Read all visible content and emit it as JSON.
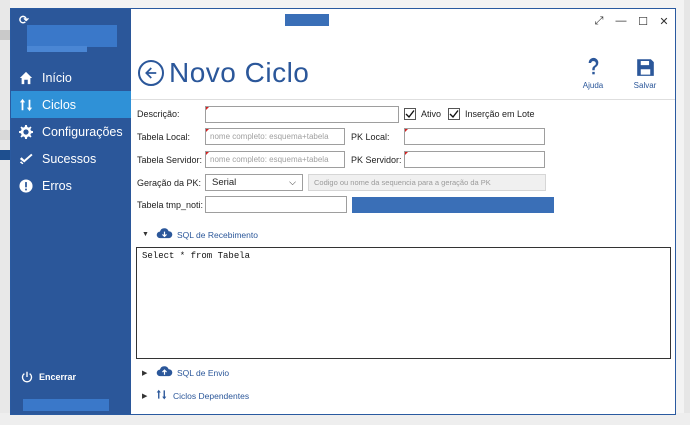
{
  "nav": {
    "items": [
      {
        "label": "Início",
        "icon": "home-icon"
      },
      {
        "label": "Ciclos",
        "icon": "cycle-arrows-icon",
        "active": true
      },
      {
        "label": "Configurações",
        "icon": "gear-icon"
      },
      {
        "label": "Sucessos",
        "icon": "check-icon"
      },
      {
        "label": "Erros",
        "icon": "error-icon"
      }
    ],
    "exit_label": "Encerrar"
  },
  "header": {
    "title": "Novo Ciclo",
    "help_label": "Ajuda",
    "save_label": "Salvar"
  },
  "form": {
    "descricao_label": "Descrição:",
    "ativo_label": "Ativo",
    "ativo_checked": true,
    "lote_label": "Inserção em Lote",
    "lote_checked": true,
    "tabela_local_label": "Tabela Local:",
    "tabela_local_placeholder": "nome completo: esquema+tabela",
    "pk_local_label": "PK Local:",
    "tabela_servidor_label": "Tabela Servidor:",
    "tabela_servidor_placeholder": "nome completo: esquema+tabela",
    "pk_servidor_label": "PK Servidor:",
    "geracao_pk_label": "Geração da PK:",
    "geracao_pk_value": "Serial",
    "sequencia_placeholder": "Codigo ou nome da sequencia para a geração da PK",
    "tabela_tmp_label": "Tabela tmp_noti:"
  },
  "sections": {
    "recebimento_label": "SQL de Recebimento",
    "recebimento_sql": "Select * from Tabela",
    "envio_label": "SQL de Envio",
    "dependentes_label": "Ciclos Dependentes"
  },
  "colors": {
    "sidebar": "#2b579a",
    "active": "#2f91d7",
    "accent": "#2b579a",
    "required_mark": "#d42020"
  }
}
